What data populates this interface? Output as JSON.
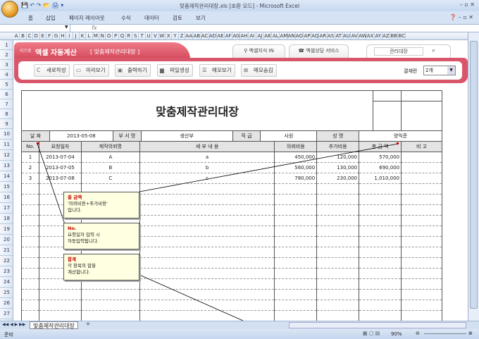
{
  "window": {
    "title": "맞춤제작관리대장.xls  [호환 모드] - Microsoft Excel"
  },
  "ribbon": {
    "tabs": [
      "홈",
      "삽입",
      "페이지 레이아웃",
      "수식",
      "데이터",
      "검토",
      "보기"
    ]
  },
  "formula_bar": {
    "name_box": "",
    "fx": "fx",
    "value": ""
  },
  "columns": [
    "A",
    "B",
    "C",
    "D",
    "E",
    "F",
    "G",
    "H",
    "I",
    "J",
    "K",
    "L",
    "M",
    "N",
    "O",
    "P",
    "Q",
    "R",
    "S",
    "T",
    "U",
    "V",
    "W",
    "X",
    "Y",
    "Z",
    "AA",
    "AB",
    "AC",
    "AD",
    "AE",
    "AF",
    "AG",
    "AH",
    "AI",
    "AJ",
    "AK",
    "AL",
    "AM",
    "AN",
    "AO",
    "AP",
    "AQ",
    "AR",
    "AS",
    "AT",
    "AU",
    "AV",
    "AW",
    "AX",
    "AY",
    "AZ",
    "BB",
    "BC"
  ],
  "banner": {
    "brand_small": "비즈폼",
    "brand": "엑셀 자동계산",
    "subtitle": "[ 맞춤제작관리대장 ]",
    "tab1": "엑셀지식 IN",
    "tab2": "엑셀상담 서비스",
    "search_value": "관리대장",
    "buttons": [
      "새로작성",
      "미리보기",
      "출력하기",
      "파일생성",
      "메모보기",
      "메모숨김"
    ],
    "approval_label": "결재란",
    "approval_value": "2개"
  },
  "sheet": {
    "title": "맞춤제작관리대장",
    "info": {
      "date_label": "날 짜",
      "date": "2013-05-08",
      "dept_label": "부 서 명",
      "dept": "생산부",
      "rank_label": "직 급",
      "rank": "사원",
      "name_label": "성 명",
      "name": "양익준"
    },
    "headers": [
      "No.",
      "요청일자",
      "제작의뢰명",
      "세  부  내  용",
      "의뢰비용",
      "추가비용",
      "총 금 액",
      "비  고"
    ],
    "rows": [
      [
        "1",
        "2013-07-04",
        "A",
        "a",
        "450,000",
        "120,000",
        "570,000",
        ""
      ],
      [
        "2",
        "2013-07-05",
        "B",
        "b",
        "560,000",
        "130,000",
        "690,000",
        ""
      ],
      [
        "3",
        "2013-07-08",
        "C",
        "c",
        "780,000",
        "230,000",
        "1,010,000",
        ""
      ]
    ]
  },
  "memos": [
    {
      "title": "총 금액",
      "lines": [
        "'의뢰비용+추가비용'",
        "입니다."
      ]
    },
    {
      "title": "No.",
      "lines": [
        "요청일자 입력 시",
        "자동입력됩니다."
      ]
    },
    {
      "title": "합계",
      "lines": [
        "각 항목의 합을",
        "계산합니다."
      ]
    }
  ],
  "sheet_tabs": [
    "맞춤제작관리대장"
  ],
  "status": {
    "ready": "준비",
    "zoom": "90%"
  }
}
